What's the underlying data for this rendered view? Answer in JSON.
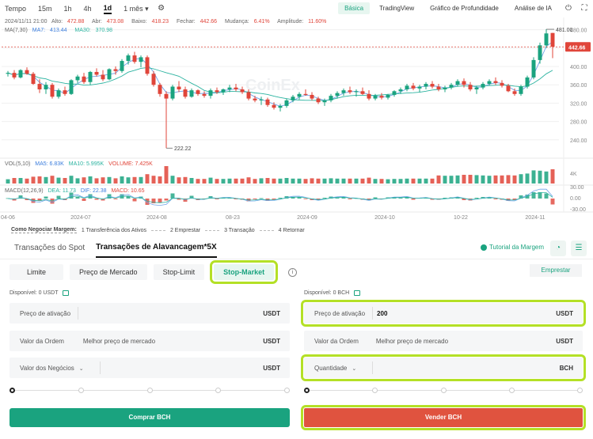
{
  "toolbar": {
    "intervals": [
      "Tempo",
      "15m",
      "1h",
      "4h",
      "1d",
      "1 mês"
    ],
    "active_interval": "1d",
    "views": [
      "Básica",
      "TradingView",
      "Gráfico de Profundidade",
      "Análise de IA"
    ],
    "active_view": "Básica"
  },
  "ohlc": {
    "date": "2024/11/11 21:00",
    "high_label": "Alto:",
    "high": "472.88",
    "open_label": "Abr:",
    "open": "473.08",
    "low_label": "Baixo:",
    "low": "418.23",
    "close_label": "Fechar:",
    "close": "442.66",
    "change_label": "Mudança:",
    "change": "6.41%",
    "amp_label": "Amplitude:",
    "amp": "11.60%"
  },
  "ma": {
    "label": "MA(7,30)",
    "ma7_label": "MA7:",
    "ma7": "413.44",
    "ma30_label": "MA30:",
    "ma30": "370.98"
  },
  "vol": {
    "label": "VOL(5,10)",
    "ma5": "MA5: 6.83K",
    "ma10": "MA10: 5.995K",
    "volume": "VOLUME: 7.425K"
  },
  "macd": {
    "label": "MACD(12,26,9)",
    "dea": "DEA: 11.73",
    "dif": "DIF: 22.38",
    "macd": "MACD: 10.65"
  },
  "chart_data": {
    "type": "candlestick",
    "title": "",
    "price_axis_ticks": [
      "480.00",
      "440.00",
      "400.00",
      "360.00",
      "320.00",
      "280.00",
      "240.00"
    ],
    "current_price": "442.66",
    "max_marker": "481.00",
    "min_marker": "222.22",
    "volume_axis_ticks": [
      "4K"
    ],
    "macd_axis_ticks": [
      "30.00",
      "0.00",
      "-30.00"
    ],
    "x_ticks": [
      "04-06",
      "2024-07",
      "2024-08",
      "08-23",
      "2024-09",
      "2024-10",
      "10-22",
      "2024-11"
    ],
    "watermark": "CoinEx",
    "candles": [
      [
        384,
        390,
        378,
        386
      ],
      [
        386,
        392,
        372,
        376
      ],
      [
        376,
        394,
        374,
        392
      ],
      [
        392,
        398,
        382,
        384
      ],
      [
        384,
        388,
        360,
        362
      ],
      [
        362,
        372,
        342,
        350
      ],
      [
        350,
        366,
        340,
        360
      ],
      [
        360,
        364,
        330,
        334
      ],
      [
        334,
        352,
        330,
        348
      ],
      [
        348,
        356,
        336,
        340
      ],
      [
        340,
        372,
        338,
        370
      ],
      [
        370,
        382,
        364,
        378
      ],
      [
        378,
        386,
        362,
        366
      ],
      [
        366,
        390,
        360,
        388
      ],
      [
        388,
        396,
        378,
        382
      ],
      [
        382,
        392,
        368,
        372
      ],
      [
        372,
        396,
        370,
        394
      ],
      [
        394,
        400,
        382,
        390
      ],
      [
        390,
        416,
        386,
        412
      ],
      [
        412,
        428,
        404,
        424
      ],
      [
        424,
        432,
        406,
        410
      ],
      [
        410,
        424,
        398,
        420
      ],
      [
        420,
        424,
        380,
        384
      ],
      [
        384,
        390,
        356,
        360
      ],
      [
        360,
        364,
        334,
        340
      ],
      [
        340,
        346,
        222,
        330
      ],
      [
        330,
        360,
        326,
        356
      ],
      [
        356,
        368,
        344,
        350
      ],
      [
        350,
        356,
        330,
        334
      ],
      [
        334,
        352,
        332,
        348
      ],
      [
        348,
        350,
        336,
        340
      ],
      [
        340,
        346,
        332,
        336
      ],
      [
        336,
        352,
        330,
        348
      ],
      [
        348,
        354,
        340,
        344
      ],
      [
        344,
        352,
        338,
        350
      ],
      [
        350,
        360,
        344,
        354
      ],
      [
        354,
        362,
        346,
        350
      ],
      [
        350,
        356,
        340,
        344
      ],
      [
        344,
        350,
        326,
        330
      ],
      [
        330,
        336,
        322,
        326
      ],
      [
        326,
        334,
        316,
        328
      ],
      [
        328,
        332,
        312,
        316
      ],
      [
        316,
        322,
        306,
        310
      ],
      [
        310,
        318,
        302,
        314
      ],
      [
        314,
        330,
        310,
        326
      ],
      [
        326,
        338,
        322,
        334
      ],
      [
        334,
        344,
        328,
        340
      ],
      [
        340,
        350,
        336,
        338
      ],
      [
        338,
        344,
        326,
        330
      ],
      [
        330,
        334,
        318,
        322
      ],
      [
        322,
        330,
        314,
        326
      ],
      [
        326,
        340,
        322,
        336
      ],
      [
        336,
        346,
        330,
        342
      ],
      [
        342,
        352,
        336,
        348
      ],
      [
        348,
        356,
        340,
        344
      ],
      [
        344,
        350,
        334,
        346
      ],
      [
        346,
        354,
        338,
        340
      ],
      [
        340,
        348,
        326,
        330
      ],
      [
        330,
        340,
        326,
        336
      ],
      [
        336,
        342,
        328,
        332
      ],
      [
        332,
        340,
        328,
        338
      ],
      [
        338,
        348,
        334,
        346
      ],
      [
        346,
        354,
        340,
        350
      ],
      [
        350,
        362,
        346,
        358
      ],
      [
        358,
        364,
        348,
        352
      ],
      [
        352,
        360,
        344,
        356
      ],
      [
        356,
        366,
        350,
        362
      ],
      [
        362,
        368,
        352,
        356
      ],
      [
        356,
        362,
        346,
        350
      ],
      [
        350,
        358,
        344,
        354
      ],
      [
        354,
        364,
        350,
        360
      ],
      [
        360,
        372,
        356,
        368
      ],
      [
        368,
        374,
        354,
        360
      ],
      [
        360,
        366,
        346,
        350
      ],
      [
        350,
        358,
        340,
        354
      ],
      [
        354,
        366,
        350,
        362
      ],
      [
        362,
        372,
        358,
        368
      ],
      [
        368,
        376,
        360,
        364
      ],
      [
        364,
        370,
        354,
        358
      ],
      [
        358,
        362,
        344,
        346
      ],
      [
        346,
        352,
        336,
        340
      ],
      [
        340,
        360,
        336,
        356
      ],
      [
        356,
        380,
        352,
        376
      ],
      [
        376,
        420,
        372,
        414
      ],
      [
        414,
        452,
        406,
        446
      ],
      [
        446,
        481,
        440,
        472
      ],
      [
        473,
        473,
        418,
        443
      ]
    ]
  },
  "steps": {
    "lead": "Como Negociar Margem:",
    "items": [
      "1 Transferência dos Ativos",
      "2 Emprestar",
      "3 Transação",
      "4 Retornar"
    ]
  },
  "trade_tabs": {
    "spot": "Transações do Spot",
    "margin": "Transações de Alavancagem*5X",
    "tutorial": "Tutorial da Margem"
  },
  "order_types": {
    "limit": "Limite",
    "market": "Preço de Mercado",
    "stop_limit": "Stop-Limit",
    "stop_market": "Stop-Market",
    "emprestar": "Emprestar"
  },
  "buy_form": {
    "available": "Disponível: 0 USDT",
    "trigger_label": "Preço de ativação",
    "trigger_unit": "USDT",
    "order_value_label": "Valor da Ordem",
    "order_value_ph": "Melhor preço de mercado",
    "order_value_unit": "USDT",
    "trade_value_label": "Valor dos Negócios",
    "trade_value_unit": "USDT",
    "slider_value": 0,
    "button": "Comprar BCH"
  },
  "sell_form": {
    "available": "Disponível: 0 BCH",
    "trigger_label": "Preço de ativação",
    "trigger_value": "200",
    "trigger_unit": "USDT",
    "order_value_label": "Valor da Ordem",
    "order_value_ph": "Melhor preço de mercado",
    "order_value_unit": "USDT",
    "quantity_label": "Quantidade",
    "quantity_unit": "BCH",
    "slider_value": 0,
    "button": "Vender BCH"
  },
  "colors": {
    "up": "#1aa37f",
    "down": "#e0453a",
    "highlight": "#b4e026"
  }
}
